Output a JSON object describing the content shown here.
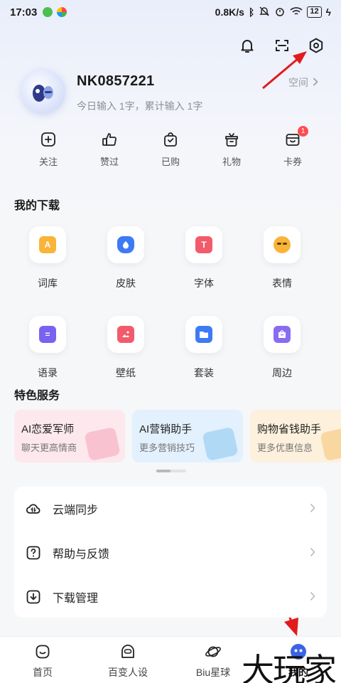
{
  "status_bar": {
    "time": "17:03",
    "network_speed": "0.8K/s",
    "battery": "12"
  },
  "profile": {
    "username": "NK0857221",
    "stats": "今日输入 1字，累计输入 1字",
    "space_label": "空间"
  },
  "quick_actions": [
    {
      "label": "关注",
      "icon": "plus-square-icon"
    },
    {
      "label": "赞过",
      "icon": "thumbs-up-icon"
    },
    {
      "label": "已购",
      "icon": "shopping-bag-icon"
    },
    {
      "label": "礼物",
      "icon": "gift-icon"
    },
    {
      "label": "卡券",
      "icon": "wallet-icon",
      "badge": "1"
    }
  ],
  "downloads": {
    "title": "我的下载",
    "items": [
      {
        "label": "词库",
        "icon": "dictionary-icon",
        "color": "#f9b43a",
        "glyph": "A"
      },
      {
        "label": "皮肤",
        "icon": "skin-icon",
        "color": "#3c7bf5",
        "glyph": ""
      },
      {
        "label": "字体",
        "icon": "font-icon",
        "color": "#f25b6b",
        "glyph": "T"
      },
      {
        "label": "表情",
        "icon": "emoji-icon",
        "color": "#f9b43a",
        "glyph": ""
      },
      {
        "label": "语录",
        "icon": "quote-icon",
        "color": "#7b61f0",
        "glyph": "="
      },
      {
        "label": "壁纸",
        "icon": "wallpaper-icon",
        "color": "#f25b6b",
        "glyph": ""
      },
      {
        "label": "套装",
        "icon": "bundle-icon",
        "color": "#3c7bf5",
        "glyph": ""
      },
      {
        "label": "周边",
        "icon": "merch-icon",
        "color": "#8a6cf2",
        "glyph": ""
      }
    ]
  },
  "services": {
    "title": "特色服务",
    "cards": [
      {
        "title": "AI恋爱军师",
        "subtitle": "聊天更高情商",
        "bg": "#fde8ee",
        "deco": "#f7b6c6"
      },
      {
        "title": "AI营销助手",
        "subtitle": "更多营销技巧",
        "bg": "#e3f0fd",
        "deco": "#9fd1f3"
      },
      {
        "title": "购物省钱助手",
        "subtitle": "更多优惠信息",
        "bg": "#fdf0dc",
        "deco": "#f5cf8d"
      }
    ]
  },
  "menu": [
    {
      "label": "云端同步",
      "icon": "cloud-sync-icon"
    },
    {
      "label": "帮助与反馈",
      "icon": "help-icon"
    },
    {
      "label": "下载管理",
      "icon": "download-icon"
    }
  ],
  "bottom_nav": [
    {
      "label": "首页",
      "icon": "home-icon"
    },
    {
      "label": "百变人设",
      "icon": "persona-icon"
    },
    {
      "label": "Biu星球",
      "icon": "planet-icon"
    },
    {
      "label": "我的",
      "icon": "profile-icon",
      "active": true
    }
  ],
  "watermark": "大玩家"
}
